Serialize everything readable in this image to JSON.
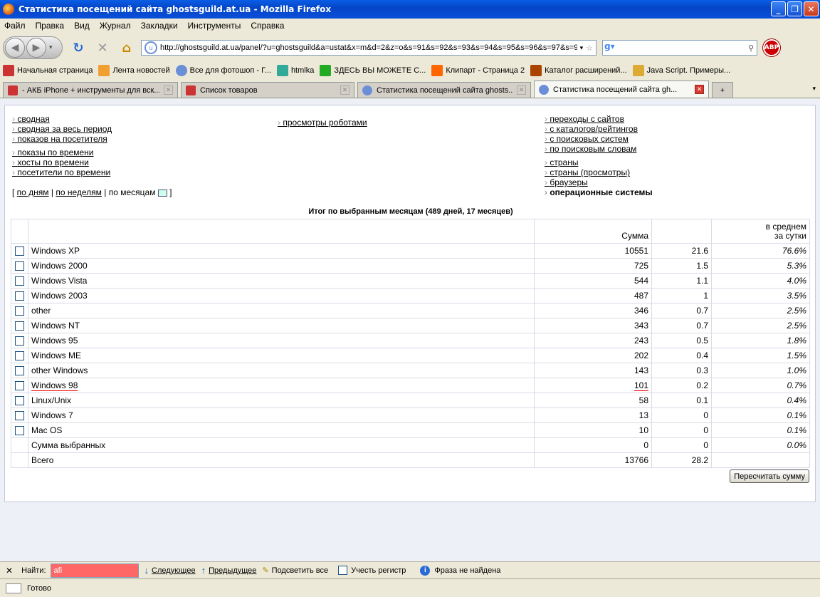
{
  "window": {
    "title": "Статистика посещений сайта ghostsguild.at.ua - Mozilla Firefox"
  },
  "menu": [
    "Файл",
    "Правка",
    "Вид",
    "Журнал",
    "Закладки",
    "Инструменты",
    "Справка"
  ],
  "nav": {
    "url": "http://ghostsguild.at.ua/panel/?u=ghostsguild&a=ustat&x=m&d=2&z=o&s=91&s=92&s=93&s=94&s=95&s=96&s=97&s=98"
  },
  "bookmarks": [
    {
      "label": "Начальная страница",
      "color": "#c33"
    },
    {
      "label": "Лента новостей",
      "color": "#f0a030"
    },
    {
      "label": "Все для фотошоп - Г...",
      "color": "#6b8fd6"
    },
    {
      "label": "htmlka",
      "color": "#3a9"
    },
    {
      "label": "ЗДЕСЬ ВЫ МОЖЕТЕ С...",
      "color": "#2a2"
    },
    {
      "label": "Клипарт - Страница 2",
      "color": "#f60"
    },
    {
      "label": "Каталог расширений...",
      "color": "#a40"
    },
    {
      "label": "Java Script. Примеры...",
      "color": "#da3"
    }
  ],
  "tabs": [
    {
      "label": "- АКБ iPhone + инструменты для вск...",
      "color": "#c33"
    },
    {
      "label": "Список товаров",
      "color": "#c33"
    },
    {
      "label": "Статистика посещений сайта ghosts...",
      "color": "#6b8fd6"
    },
    {
      "label": "Статистика посещений сайта gh...",
      "color": "#6b8fd6"
    }
  ],
  "links": {
    "col1a": [
      "сводная",
      "сводная за весь период",
      "показов на посетителя"
    ],
    "col1b": [
      "показы по времени",
      "хосты по времени",
      "посетители по времени"
    ],
    "col2": [
      "просмотры роботами"
    ],
    "col3a": [
      "переходы с сайтов",
      "с каталогов/рейтингов",
      "с поисковых систем",
      "по поисковым словам"
    ],
    "col3b": [
      "страны",
      "страны (просмотры)",
      "браузеры"
    ],
    "col3_active": "операционные системы"
  },
  "period": {
    "by_days": "по дням",
    "by_weeks": "по неделям",
    "by_months": "по месяцам"
  },
  "caption": "Итог по выбранным месяцам (489 дней, 17 месяцев)",
  "table": {
    "head": {
      "sum": "Сумма",
      "avg_line1": "в среднем",
      "avg_line2": "за сутки"
    },
    "rows": [
      {
        "name": "Windows XP",
        "sum": "10551",
        "avg": "21.6",
        "pct": "76.6%"
      },
      {
        "name": "Windows 2000",
        "sum": "725",
        "avg": "1.5",
        "pct": "5.3%"
      },
      {
        "name": "Windows Vista",
        "sum": "544",
        "avg": "1.1",
        "pct": "4.0%"
      },
      {
        "name": "Windows 2003",
        "sum": "487",
        "avg": "1",
        "pct": "3.5%"
      },
      {
        "name": "other",
        "sum": "346",
        "avg": "0.7",
        "pct": "2.5%"
      },
      {
        "name": "Windows NT",
        "sum": "343",
        "avg": "0.7",
        "pct": "2.5%"
      },
      {
        "name": "Windows 95",
        "sum": "243",
        "avg": "0.5",
        "pct": "1.8%"
      },
      {
        "name": "Windows ME",
        "sum": "202",
        "avg": "0.4",
        "pct": "1.5%"
      },
      {
        "name": "other Windows",
        "sum": "143",
        "avg": "0.3",
        "pct": "1.0%"
      },
      {
        "name": "Windows 98",
        "sum": "101",
        "avg": "0.2",
        "pct": "0.7%"
      },
      {
        "name": "Linux/Unix",
        "sum": "58",
        "avg": "0.1",
        "pct": "0.4%"
      },
      {
        "name": "Windows 7",
        "sum": "13",
        "avg": "0",
        "pct": "0.1%"
      },
      {
        "name": "Mac OS",
        "sum": "10",
        "avg": "0",
        "pct": "0.1%"
      }
    ],
    "selected": {
      "name": "Сумма выбранных",
      "sum": "0",
      "avg": "0",
      "pct": "0.0%"
    },
    "total": {
      "name": "Всего",
      "sum": "13766",
      "avg": "28.2"
    }
  },
  "recalc": "Пересчитать сумму",
  "find": {
    "label": "Найти:",
    "value": "afi",
    "next": "Следующее",
    "prev": "Предыдущее",
    "highlight": "Подсветить все",
    "matchcase": "Учесть регистр",
    "status": "Фраза не найдена"
  },
  "status": "Готово"
}
